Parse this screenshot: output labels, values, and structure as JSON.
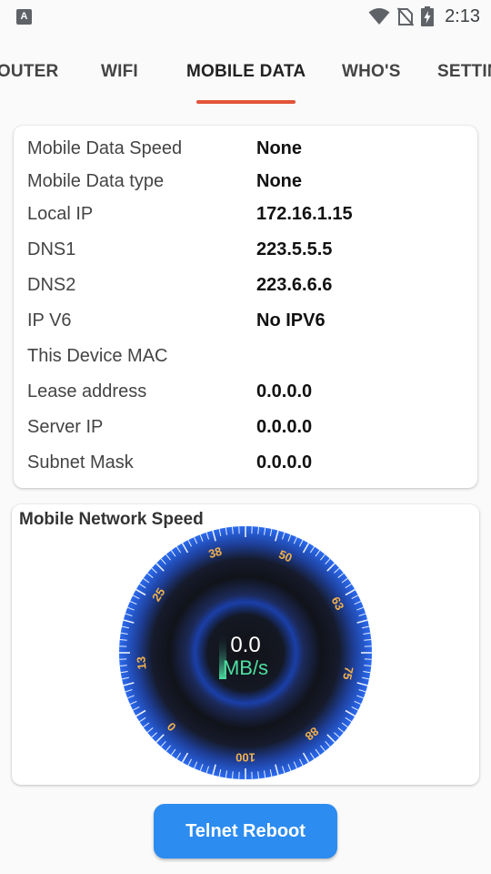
{
  "status_bar": {
    "notification_letter": "A",
    "time": "2:13",
    "icons": [
      "wifi-icon",
      "no-sim-icon",
      "battery-charging-icon"
    ]
  },
  "tabs": [
    {
      "label": "ROUTER",
      "active": false
    },
    {
      "label": "WIFI",
      "active": false
    },
    {
      "label": "MOBILE DATA",
      "active": true
    },
    {
      "label": "WHO'S",
      "active": false
    },
    {
      "label": "SETTINGS",
      "active": false
    }
  ],
  "info": [
    {
      "label": "Mobile Data Speed",
      "value": "None"
    },
    {
      "label": "Mobile Data type",
      "value": "None"
    },
    {
      "label": "Local IP",
      "value": "172.16.1.15"
    },
    {
      "label": "DNS1",
      "value": "223.5.5.5"
    },
    {
      "label": "DNS2",
      "value": "223.6.6.6"
    },
    {
      "label": "IP V6",
      "value": "No IPV6"
    },
    {
      "label": "This Device MAC",
      "value": ""
    },
    {
      "label": "Lease address",
      "value": "0.0.0.0"
    },
    {
      "label": "Server IP",
      "value": "0.0.0.0"
    },
    {
      "label": "Subnet Mask",
      "value": "0.0.0.0"
    }
  ],
  "speed": {
    "title": "Mobile Network Speed",
    "value": "0.0",
    "unit": "MB/s",
    "scale_labels": [
      "0",
      "13",
      "25",
      "38",
      "50",
      "63",
      "75",
      "88",
      "100"
    ],
    "min": 0,
    "max": 100,
    "level": 0
  },
  "reboot_button": "Telnet Reboot",
  "colors": {
    "accent": "#e2543a",
    "button": "#2c8cf0",
    "gauge_blue": "#1e5fd6",
    "gauge_label": "#f2b24a",
    "value_green": "#4de0a0"
  }
}
